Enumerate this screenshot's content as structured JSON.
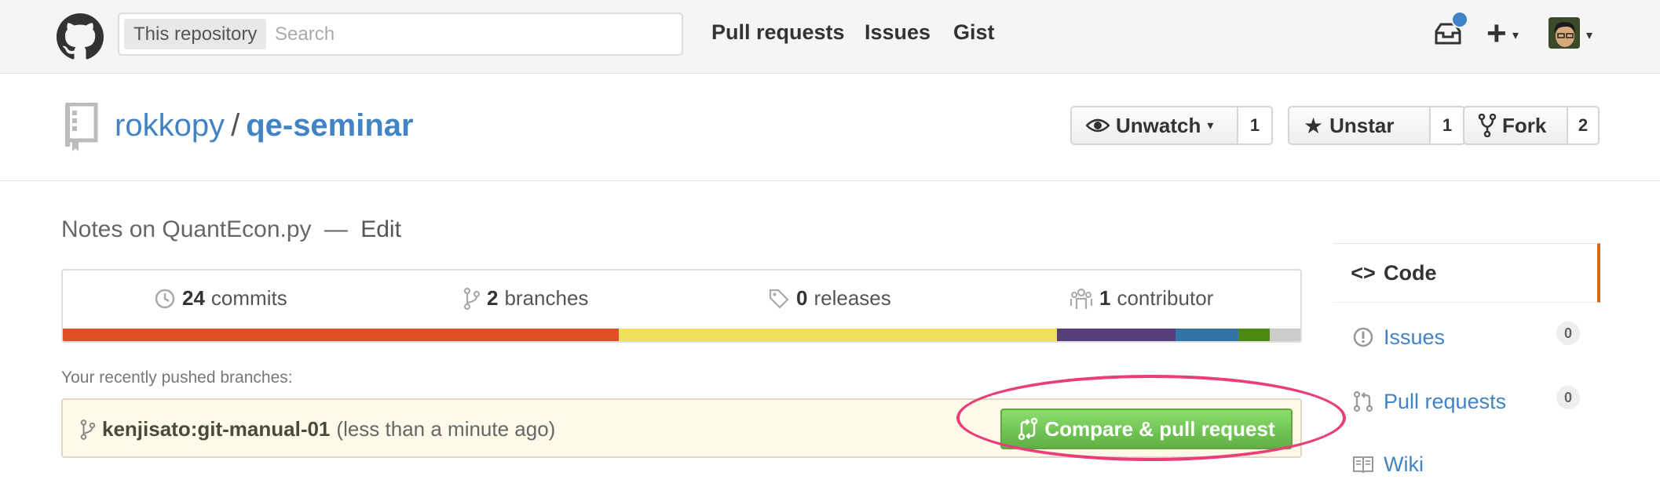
{
  "header": {
    "search_scope": "This repository",
    "search_placeholder": "Search",
    "nav": [
      "Pull requests",
      "Issues",
      "Gist"
    ]
  },
  "repo": {
    "owner": "rokkopy",
    "separator": "/",
    "name": "qe-seminar",
    "description": "Notes on QuantEcon.py",
    "desc_separator": "—",
    "edit_label": "Edit"
  },
  "actions": {
    "watch": {
      "label": "Unwatch",
      "count": "1"
    },
    "star": {
      "label": "Unstar",
      "count": "1"
    },
    "fork": {
      "label": "Fork",
      "count": "2"
    }
  },
  "stats": {
    "commits": {
      "count": "24",
      "label": "commits"
    },
    "branches": {
      "count": "2",
      "label": "branches"
    },
    "releases": {
      "count": "0",
      "label": "releases"
    },
    "contributors": {
      "count": "1",
      "label": "contributor"
    }
  },
  "language_bar": [
    {
      "color": "#e34c26",
      "share": 44.9
    },
    {
      "color": "#f1e05a",
      "share": 35.4
    },
    {
      "color": "#563d7c",
      "share": 9.6
    },
    {
      "color": "#3572A5",
      "share": 5.1
    },
    {
      "color": "#2b7489",
      "share": 0.0
    },
    {
      "color": "#4b8b14",
      "share": 2.5
    },
    {
      "color": "#cccccc",
      "share": 2.5
    }
  ],
  "recent": {
    "label": "Your recently pushed branches:",
    "branch": "kenjisato:git-manual-01",
    "time": "(less than a minute ago)",
    "button": "Compare & pull request"
  },
  "sidebar": {
    "items": [
      {
        "label": "Code"
      },
      {
        "label": "Issues",
        "count": "0"
      },
      {
        "label": "Pull requests",
        "count": "0"
      },
      {
        "label": "Wiki"
      }
    ]
  },
  "colors": {
    "link": "#4183c4",
    "primary_button": "#60b044",
    "highlight_ring": "#ea3e7a",
    "selected_tab_accent": "#d26911"
  }
}
